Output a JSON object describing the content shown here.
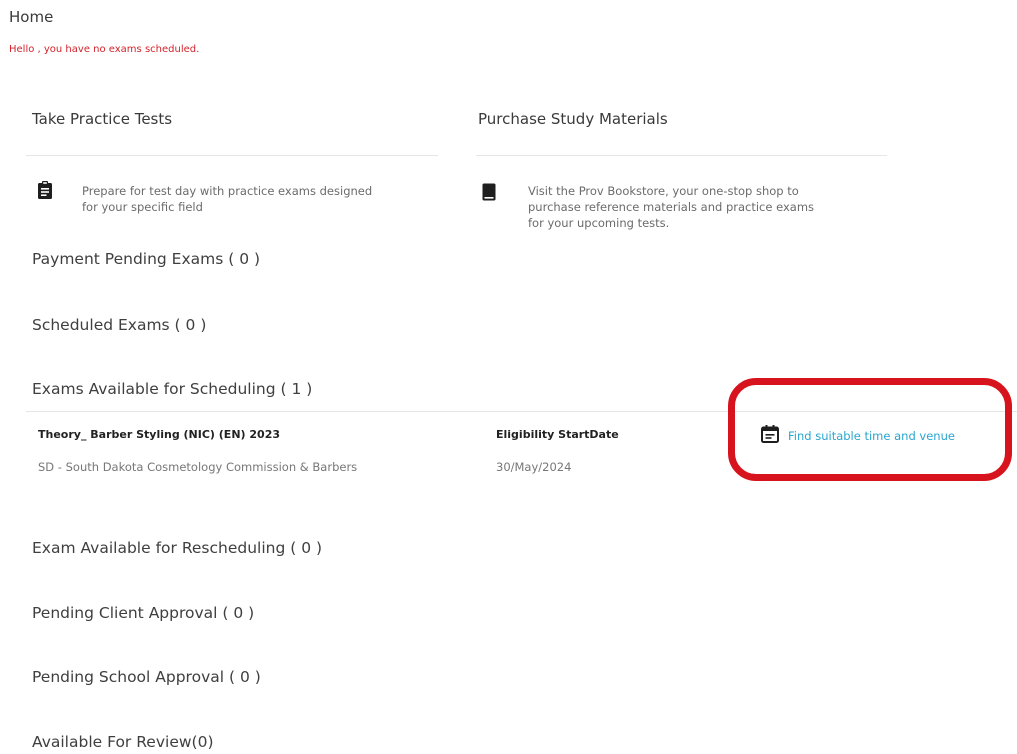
{
  "page": {
    "title": "Home",
    "greeting": "Hello , you have no exams scheduled."
  },
  "cards": {
    "practice": {
      "title": "Take Practice Tests",
      "description_line1": "Prepare for test day with practice exams designed",
      "description_line2": "for your specific field",
      "icon": "clipboard-icon"
    },
    "materials": {
      "title": "Purchase Study Materials",
      "description_line1": "Visit the Prov Bookstore, your one-stop shop to",
      "description_line2": "purchase reference materials and practice exams",
      "description_line3": "for your upcoming tests.",
      "icon": "book-icon"
    }
  },
  "sections": {
    "payment_pending": "Payment Pending Exams ( 0 )",
    "scheduled": "Scheduled Exams ( 0 )",
    "available_scheduling": "Exams Available for Scheduling ( 1 )",
    "rescheduling": "Exam Available for Rescheduling ( 0 )",
    "client_approval": "Pending Client Approval ( 0 )",
    "school_approval": "Pending School Approval ( 0 )",
    "review": "Available For Review(0)"
  },
  "exam": {
    "name": "Theory_ Barber Styling (NIC) (EN) 2023",
    "organization": "SD - South Dakota Cosmetology Commission & Barbers",
    "eligibility_label": "Eligibility StartDate",
    "eligibility_date": "30/May/2024",
    "action_label": "Find suitable time and venue",
    "action_icon": "calendar-icon"
  },
  "colors": {
    "greeting": "#d3232b",
    "link": "#2aa6cf",
    "highlight": "#d7141e"
  }
}
